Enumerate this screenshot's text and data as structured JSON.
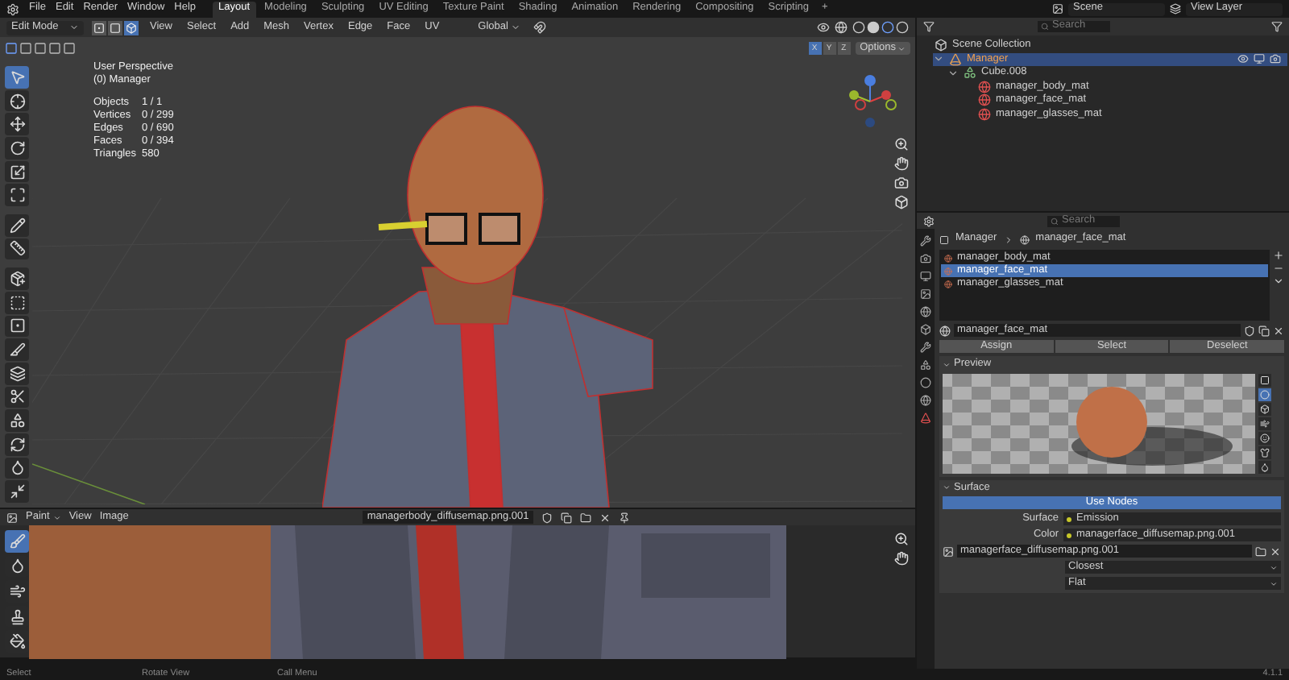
{
  "top_menu": [
    "File",
    "Edit",
    "Render",
    "Window",
    "Help"
  ],
  "workspace_tabs": [
    {
      "label": "Layout",
      "selected": true
    },
    {
      "label": "Modeling",
      "selected": false
    },
    {
      "label": "Sculpting",
      "selected": false
    },
    {
      "label": "UV Editing",
      "selected": false
    },
    {
      "label": "Texture Paint",
      "selected": false
    },
    {
      "label": "Shading",
      "selected": false
    },
    {
      "label": "Animation",
      "selected": false
    },
    {
      "label": "Rendering",
      "selected": false
    },
    {
      "label": "Compositing",
      "selected": false
    },
    {
      "label": "Scripting",
      "selected": false
    }
  ],
  "add_tab": "+",
  "scene": {
    "value": "Scene"
  },
  "view_layer": {
    "value": "View Layer"
  },
  "viewport": {
    "mode": "Edit Mode",
    "mesh_select_modes": [
      {
        "kind": "vertex",
        "selected": false
      },
      {
        "kind": "edge",
        "selected": false
      },
      {
        "kind": "face",
        "selected": true
      }
    ],
    "menus": [
      "View",
      "Select",
      "Add",
      "Mesh",
      "Vertex",
      "Edge",
      "Face",
      "UV"
    ],
    "orientation": "Global",
    "mirror_axes": [
      {
        "label": "X",
        "selected": true
      },
      {
        "label": "Y",
        "selected": false
      },
      {
        "label": "Z",
        "selected": false
      }
    ],
    "options": "Options",
    "overlay_lines": [
      "User Perspective",
      "(0) Manager"
    ],
    "stats": [
      {
        "label": "Objects",
        "value": "1 / 1"
      },
      {
        "label": "Vertices",
        "value": "0 / 299"
      },
      {
        "label": "Edges",
        "value": "0 / 690"
      },
      {
        "label": "Faces",
        "value": "0 / 394"
      },
      {
        "label": "Triangles",
        "value": "580"
      }
    ],
    "tools": [
      {
        "kind": "select",
        "selected": true
      },
      {
        "kind": "cursor",
        "selected": false
      },
      {
        "kind": "move",
        "selected": false
      },
      {
        "kind": "rotate",
        "selected": false
      },
      {
        "kind": "scale",
        "selected": false
      },
      {
        "kind": "transform",
        "selected": false
      },
      {
        "kind": "annotate",
        "selected": false
      },
      {
        "kind": "measure",
        "selected": false
      },
      {
        "kind": "add",
        "selected": false
      },
      {
        "kind": "extrude",
        "selected": false
      },
      {
        "kind": "inset",
        "selected": false
      },
      {
        "kind": "bevel",
        "selected": false
      },
      {
        "kind": "loopcut",
        "selected": false
      },
      {
        "kind": "knife",
        "selected": false
      },
      {
        "kind": "polybuild",
        "selected": false
      },
      {
        "kind": "spin",
        "selected": false
      },
      {
        "kind": "smooth",
        "selected": false
      },
      {
        "kind": "shrink",
        "selected": false
      }
    ]
  },
  "outliner": {
    "search_placeholder": "Search",
    "tree": [
      {
        "label": "Scene Collection",
        "kind": "collection",
        "selected": false,
        "children": [
          {
            "label": "Manager",
            "kind": "object",
            "selected": true,
            "expanded": true,
            "children": [
              {
                "label": "Cube.008",
                "kind": "mesh",
                "selected": false,
                "expanded": true,
                "children": [
                  {
                    "label": "manager_body_mat",
                    "kind": "material",
                    "selected": false
                  },
                  {
                    "label": "manager_face_mat",
                    "kind": "material",
                    "selected": false
                  },
                  {
                    "label": "manager_glasses_mat",
                    "kind": "material",
                    "selected": false
                  }
                ]
              }
            ]
          }
        ]
      }
    ]
  },
  "properties": {
    "search_placeholder": "Search",
    "breadcrumb": [
      "Manager",
      "manager_face_mat"
    ],
    "material_slots": [
      {
        "label": "manager_body_mat",
        "selected": false
      },
      {
        "label": "manager_face_mat",
        "selected": true
      },
      {
        "label": "manager_glasses_mat",
        "selected": false
      }
    ],
    "material_name": "manager_face_mat",
    "slot_buttons": [
      "Assign",
      "Select",
      "Deselect"
    ],
    "preview_title": "Preview",
    "preview_shapes": [
      {
        "kind": "plane",
        "selected": false
      },
      {
        "kind": "sphere",
        "selected": true
      },
      {
        "kind": "cube",
        "selected": false
      },
      {
        "kind": "hair",
        "selected": false
      },
      {
        "kind": "monkey",
        "selected": false
      },
      {
        "kind": "cloth",
        "selected": false
      },
      {
        "kind": "fluid",
        "selected": false
      }
    ],
    "surface_title": "Surface",
    "use_nodes": "Use Nodes",
    "fields": [
      {
        "label": "Surface",
        "value": "Emission"
      },
      {
        "label": "Color",
        "value": "managerface_diffusemap.png.001"
      }
    ],
    "image_name": "managerface_diffusemap.png.001",
    "dropdowns": [
      "Closest",
      "Flat"
    ]
  },
  "image_editor": {
    "mode": "Paint",
    "menus": [
      "View",
      "Image"
    ],
    "image_name": "managerbody_diffusemap.png.001",
    "tools": [
      {
        "kind": "draw",
        "selected": true
      },
      {
        "kind": "soften",
        "selected": false
      },
      {
        "kind": "smear",
        "selected": false
      },
      {
        "kind": "clone",
        "selected": false
      },
      {
        "kind": "fill",
        "selected": false
      }
    ]
  },
  "status_bar": {
    "hints": [
      "Select",
      "Rotate View",
      "Call Menu"
    ],
    "version": "4.1.1"
  }
}
